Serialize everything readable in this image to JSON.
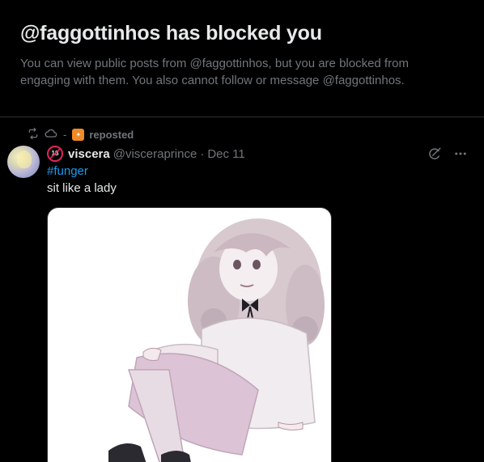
{
  "block_notice": {
    "title": "@faggottinhos has blocked you",
    "description": "You can view public posts from @faggottinhos, but you are blocked from engaging with them. You also cannot follow or message @faggottinhos."
  },
  "repost": {
    "separator": "-",
    "label": "reposted"
  },
  "post": {
    "age_badge": "18",
    "display_name": "viscera",
    "handle": "@visceraprince",
    "dot": "·",
    "date": "Dec 11",
    "hashtag": "#funger",
    "text": "sit like a lady"
  },
  "icons": {
    "repost": "repost-icon",
    "cloud": "cloud-icon",
    "grok": "grok-icon",
    "more": "more-icon"
  },
  "colors": {
    "background": "#000000",
    "primary_text": "#e7e9ea",
    "secondary_text": "#71767b",
    "link": "#1d9bf0",
    "divider": "#2f3336",
    "age_badge": "#e0245e"
  }
}
